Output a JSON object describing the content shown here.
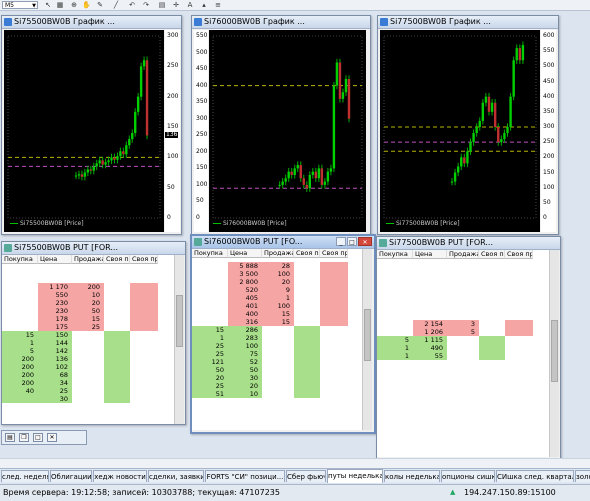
{
  "toolbar": {
    "timeframe": "M5",
    "icons": [
      "arrow-icon",
      "grid-icon",
      "zoom-icon",
      "undo-icon",
      "redo-icon",
      "edit-icon",
      "chart-icon",
      "cursor-icon",
      "plus-icon",
      "marker-icon",
      "text-icon",
      "fibo-icon"
    ]
  },
  "charts": [
    {
      "title": "Si75500BW0B График ...",
      "legend": "Si75500BW0B [Price]",
      "y_ticks": [
        "300",
        "250",
        "200",
        "150",
        "100",
        "50",
        "0"
      ],
      "current_label": "136",
      "chart_data": {
        "type": "candlestick",
        "series": [
          {
            "name": "Si75500BW0B [Price]",
            "ylim": [
              0,
              300
            ],
            "last": 136,
            "values": [
              70,
              72,
              68,
              75,
              80,
              78,
              85,
              90,
              95,
              88,
              92,
              95,
              100,
              96,
              102,
              110,
              105,
              120,
              130,
              140,
              175,
              200,
              250,
              260,
              136
            ]
          }
        ],
        "lines": [
          {
            "value": 100,
            "style": "dashed"
          },
          {
            "value": 85,
            "style": "dashed"
          }
        ]
      }
    },
    {
      "title": "Si76000BW0B График ...",
      "legend": "Si76000BW0B [Price]",
      "y_ticks": [
        "550",
        "500",
        "450",
        "400",
        "350",
        "300",
        "250",
        "200",
        "150",
        "100",
        "50",
        "0"
      ],
      "current_label": "",
      "chart_data": {
        "type": "candlestick",
        "series": [
          {
            "name": "Si76000BW0B [Price]",
            "ylim": [
              0,
              550
            ],
            "values": [
              100,
              110,
              120,
              140,
              130,
              150,
              160,
              120,
              100,
              90,
              130,
              140,
              120,
              150,
              100,
              110,
              140,
              150,
              400,
              470,
              360,
              380,
              420,
              300
            ]
          }
        ],
        "lines": [
          {
            "value": 400,
            "style": "dashed"
          },
          {
            "value": 90,
            "style": "dashed"
          }
        ]
      }
    },
    {
      "title": "Si77500BW0B График ...",
      "legend": "Si77500BW0B [Price]",
      "y_ticks": [
        "600",
        "550",
        "500",
        "450",
        "400",
        "350",
        "300",
        "250",
        "200",
        "150",
        "100",
        "50",
        "0"
      ],
      "current_label": "",
      "chart_data": {
        "type": "candlestick",
        "series": [
          {
            "name": "Si77500BW0B [Price]",
            "ylim": [
              0,
              600
            ],
            "values": [
              120,
              150,
              170,
              200,
              180,
              220,
              250,
              280,
              300,
              320,
              380,
              400,
              350,
              380,
              300,
              250,
              260,
              280,
              300,
              400,
              520,
              560,
              520,
              570
            ]
          }
        ],
        "lines": [
          {
            "value": 300,
            "style": "dashed"
          },
          {
            "value": 250,
            "style": "dashed"
          },
          {
            "value": 220,
            "style": "dashed"
          }
        ]
      }
    }
  ],
  "quote_windows": [
    {
      "title": "Si75500BW0B PUT [FOR...",
      "headers": [
        "Покупка",
        "Цена",
        "Продажа",
        "Своя по",
        "Своя пр"
      ],
      "rows": [
        {
          "buy": "",
          "price": "1 170",
          "sell": "200"
        },
        {
          "buy": "",
          "price": "550",
          "sell": "10"
        },
        {
          "buy": "",
          "price": "230",
          "sell": "20"
        },
        {
          "buy": "",
          "price": "230",
          "sell": "50"
        },
        {
          "buy": "",
          "price": "178",
          "sell": "15"
        },
        {
          "buy": "",
          "price": "175",
          "sell": "25"
        },
        {
          "buy": "15",
          "price": "150",
          "sell": ""
        },
        {
          "buy": "1",
          "price": "144",
          "sell": ""
        },
        {
          "buy": "5",
          "price": "142",
          "sell": ""
        },
        {
          "buy": "200",
          "price": "136",
          "sell": ""
        },
        {
          "buy": "200",
          "price": "102",
          "sell": ""
        },
        {
          "buy": "200",
          "price": "68",
          "sell": ""
        },
        {
          "buy": "200",
          "price": "34",
          "sell": ""
        },
        {
          "buy": "40",
          "price": "25",
          "sell": ""
        },
        {
          "buy": "",
          "price": "30",
          "sell": ""
        }
      ]
    },
    {
      "title": "Si76000BW0B PUT [FO...",
      "headers": [
        "Покупка",
        "Цена",
        "Продажа",
        "Своя по",
        "Своя пр"
      ],
      "rows": [
        {
          "buy": "",
          "price": "5 888",
          "sell": "28"
        },
        {
          "buy": "",
          "price": "3 500",
          "sell": "100"
        },
        {
          "buy": "",
          "price": "2 800",
          "sell": "20"
        },
        {
          "buy": "",
          "price": "520",
          "sell": "9"
        },
        {
          "buy": "",
          "price": "405",
          "sell": "1"
        },
        {
          "buy": "",
          "price": "401",
          "sell": "100"
        },
        {
          "buy": "",
          "price": "400",
          "sell": "15"
        },
        {
          "buy": "",
          "price": "316",
          "sell": "15"
        },
        {
          "buy": "15",
          "price": "286",
          "sell": ""
        },
        {
          "buy": "1",
          "price": "283",
          "sell": ""
        },
        {
          "buy": "25",
          "price": "100",
          "sell": ""
        },
        {
          "buy": "25",
          "price": "75",
          "sell": ""
        },
        {
          "buy": "121",
          "price": "52",
          "sell": ""
        },
        {
          "buy": "50",
          "price": "50",
          "sell": ""
        },
        {
          "buy": "20",
          "price": "30",
          "sell": ""
        },
        {
          "buy": "25",
          "price": "20",
          "sell": ""
        },
        {
          "buy": "51",
          "price": "10",
          "sell": ""
        }
      ]
    },
    {
      "title": "Si77500BW0B PUT [FOR...",
      "headers": [
        "Покупка",
        "Цена",
        "Продажа",
        "Своя по",
        "Своя пр"
      ],
      "rows": [
        {
          "buy": "",
          "price": "2 154",
          "sell": "3"
        },
        {
          "buy": "",
          "price": "1 206",
          "sell": "5"
        },
        {
          "buy": "5",
          "price": "1 115",
          "sell": ""
        },
        {
          "buy": "1",
          "price": "490",
          "sell": ""
        },
        {
          "buy": "1",
          "price": "55",
          "sell": ""
        }
      ]
    }
  ],
  "tabs": [
    "след. неделя",
    "Облигации",
    "хедж новости",
    "сделки, заявки",
    "FORTS \"СИ\" позици...",
    "Сбер фьюч",
    "путы неделька",
    "колы неделька",
    "опционы сишка",
    "СИшка след. квартал",
    "золото..."
  ],
  "selected_tab": "путы неделька",
  "status": {
    "text": "Время сервера: 19:12:58; записей: 10303788; текущая: 47107235",
    "ip": "194.247.150.89:15100"
  },
  "colors": {
    "sell_bg": "#f6a5a5",
    "buy_bg": "#a7df8a",
    "chart_bg": "#000000",
    "candle": "#00c000"
  }
}
